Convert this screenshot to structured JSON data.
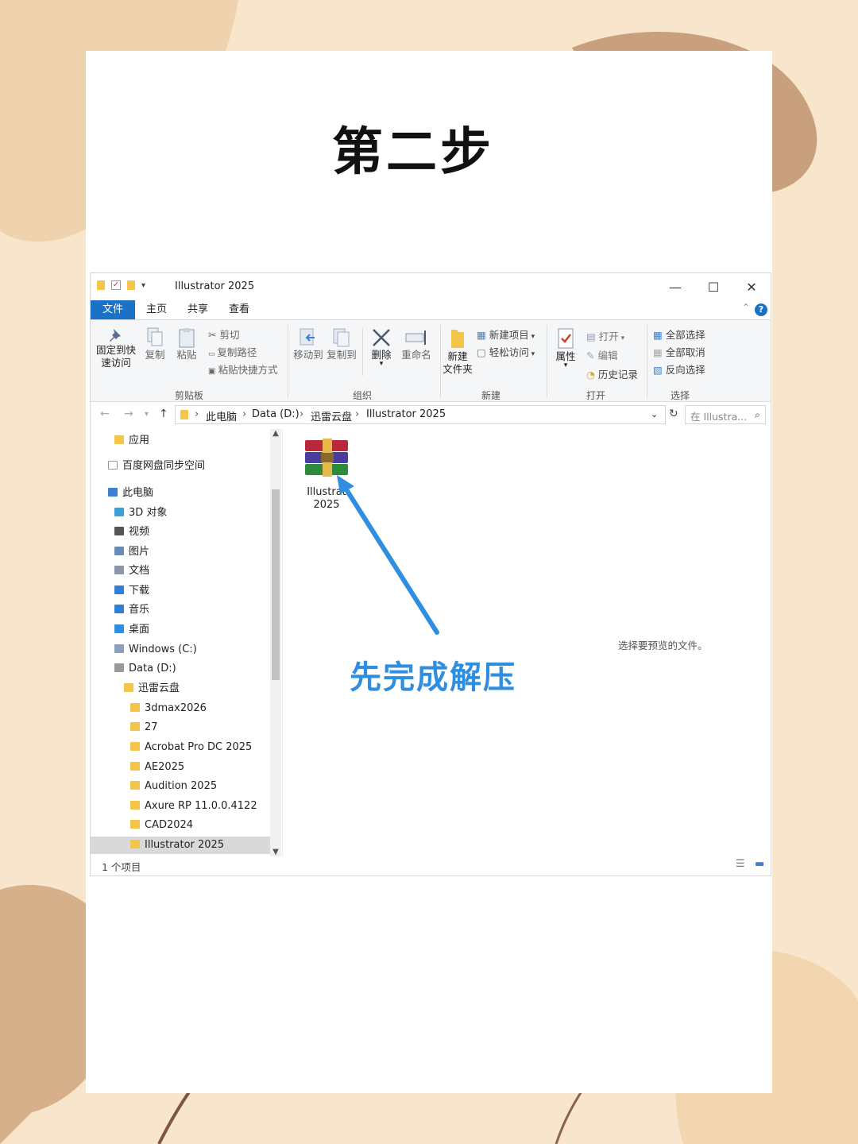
{
  "heading": "第二步",
  "window": {
    "title": "Illustrator 2025",
    "controls": {
      "minimize": "—",
      "maximize": "☐",
      "close": "✕"
    }
  },
  "tabs": [
    "文件",
    "主页",
    "共享",
    "查看"
  ],
  "ribbon": {
    "clipboard": {
      "pin_line1": "固定到快",
      "pin_line2": "速访问",
      "copy": "复制",
      "paste": "粘贴",
      "cut": "剪切",
      "copy_path": "复制路径",
      "paste_shortcut": "粘贴快捷方式",
      "group": "剪贴板"
    },
    "organize": {
      "move_to": "移动到",
      "copy_to": "复制到",
      "delete": "删除",
      "rename": "重命名",
      "group": "组织"
    },
    "new": {
      "new_item": "新建项目",
      "easy_access": "轻松访问",
      "new_folder_line1": "新建",
      "new_folder_line2": "文件夹",
      "group": "新建"
    },
    "open": {
      "properties": "属性",
      "open": "打开",
      "edit": "编辑",
      "history": "历史记录",
      "group": "打开"
    },
    "select": {
      "select_all": "全部选择",
      "select_none": "全部取消",
      "invert": "反向选择",
      "group": "选择"
    }
  },
  "address": {
    "crumbs": [
      "此电脑",
      "Data (D:)",
      "迅雷云盘",
      "Illustrator 2025"
    ],
    "search_placeholder": "在 Illustra..."
  },
  "sidebar": [
    {
      "label": "应用",
      "indent": 1
    },
    {
      "label": "百度网盘同步空间",
      "indent": 0
    },
    {
      "label": "此电脑",
      "indent": 0
    },
    {
      "label": "3D 对象",
      "indent": 1
    },
    {
      "label": "视频",
      "indent": 1
    },
    {
      "label": "图片",
      "indent": 1
    },
    {
      "label": "文档",
      "indent": 1
    },
    {
      "label": "下载",
      "indent": 1
    },
    {
      "label": "音乐",
      "indent": 1
    },
    {
      "label": "桌面",
      "indent": 1
    },
    {
      "label": "Windows (C:)",
      "indent": 1
    },
    {
      "label": "Data (D:)",
      "indent": 1
    },
    {
      "label": "迅雷云盘",
      "indent": 2
    },
    {
      "label": "3dmax2026",
      "indent": 3
    },
    {
      "label": "27",
      "indent": 3
    },
    {
      "label": "Acrobat Pro DC 2025",
      "indent": 3
    },
    {
      "label": "AE2025",
      "indent": 3
    },
    {
      "label": "Audition 2025",
      "indent": 3
    },
    {
      "label": "Axure RP 11.0.0.4122",
      "indent": 3
    },
    {
      "label": "CAD2024",
      "indent": 3
    },
    {
      "label": "Illustrator 2025",
      "indent": 3,
      "selected": true
    }
  ],
  "file": {
    "line1": "Illustrat",
    "line2": "2025"
  },
  "preview_text": "选择要预览的文件。",
  "status": "1 个项目",
  "annotation": "先完成解压",
  "colors": {
    "accent": "#1a72c7",
    "annotation": "#2f8ee0",
    "bg": "#f5e3c9",
    "leaf": "#c9a07a"
  }
}
